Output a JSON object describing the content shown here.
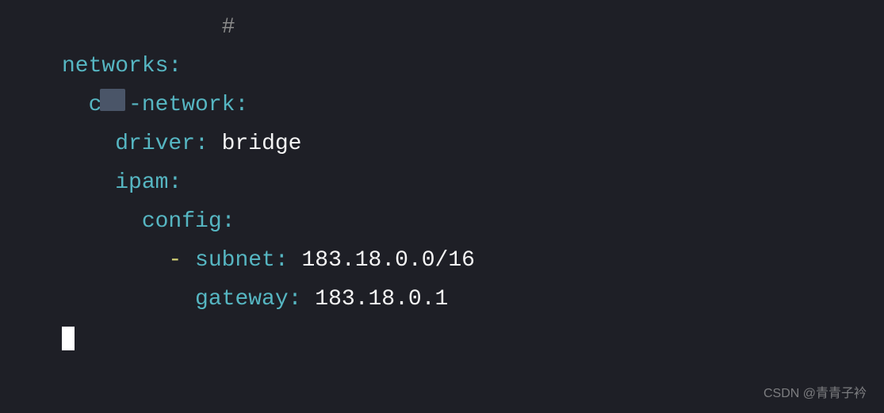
{
  "code": {
    "line1_comment": "#",
    "line2_key": "networks",
    "line3_key_before": "c",
    "line3_key_obscured": "xx",
    "line3_key_after": "-network",
    "line4_key": "driver",
    "line4_value": "bridge",
    "line5_key": "ipam",
    "line6_key": "config",
    "line7_dash": "-",
    "line7_key": "subnet",
    "line7_value": "183.18.0.0/16",
    "line8_key": "gateway",
    "line8_value": "183.18.0.1"
  },
  "indent": {
    "sp0": "",
    "sp2": "  ",
    "sp4": "    ",
    "sp6": "      ",
    "sp8": "        ",
    "sp10": "          ",
    "sp12": "            "
  },
  "watermark": "CSDN @青青子衿"
}
